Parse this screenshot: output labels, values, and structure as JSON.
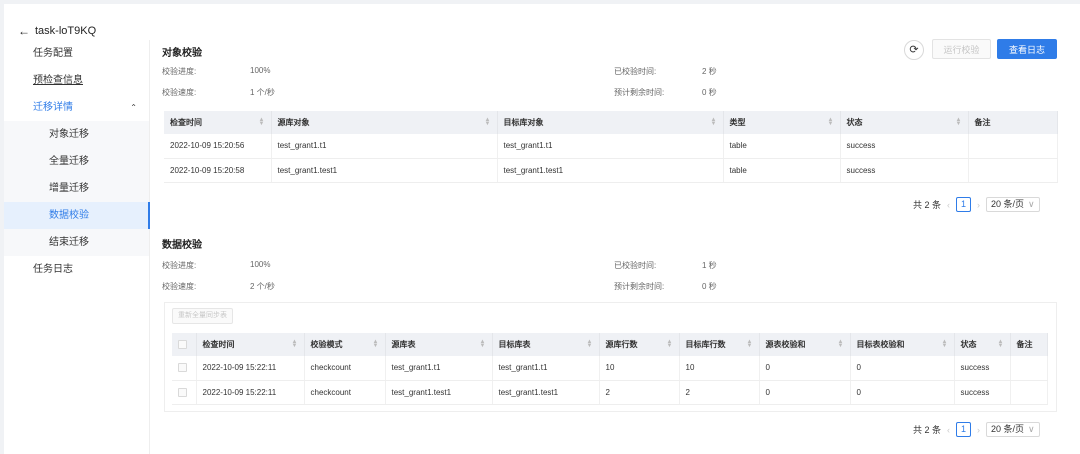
{
  "header": {
    "back_icon": "arrow-left-icon",
    "title": "task-loT9KQ"
  },
  "sidebar": {
    "items": [
      {
        "label": "任务配置"
      },
      {
        "label": "预检查信息"
      },
      {
        "label": "迁移详情"
      }
    ],
    "sub_items": [
      {
        "label": "对象迁移"
      },
      {
        "label": "全量迁移"
      },
      {
        "label": "增量迁移"
      },
      {
        "label": "数据校验"
      },
      {
        "label": "结束迁移"
      }
    ],
    "last_item": {
      "label": "任务日志"
    }
  },
  "toolbar": {
    "run_check_label": "运行校验",
    "view_log_label": "查看日志"
  },
  "object_check": {
    "title": "对象校验",
    "progress_label": "校验进度:",
    "progress_value": "100%",
    "speed_label": "校验速度:",
    "speed_value": "1 个/秒",
    "elapsed_label": "已校验时间:",
    "elapsed_value": "2 秒",
    "remaining_label": "预计剩余时间:",
    "remaining_value": "0 秒",
    "columns": [
      "检查时间",
      "源库对象",
      "目标库对象",
      "类型",
      "状态",
      "备注"
    ],
    "rows": [
      [
        "2022-10-09 15:20:56",
        "test_grant1.t1",
        "test_grant1.t1",
        "table",
        "success",
        ""
      ],
      [
        "2022-10-09 15:20:58",
        "test_grant1.test1",
        "test_grant1.test1",
        "table",
        "success",
        ""
      ]
    ],
    "pager": {
      "total": "共 2 条",
      "page": "1",
      "size": "20 条/页"
    }
  },
  "data_check": {
    "title": "数据校验",
    "progress_label": "校验进度:",
    "progress_value": "100%",
    "speed_label": "校验速度:",
    "speed_value": "2 个/秒",
    "elapsed_label": "已校验时间:",
    "elapsed_value": "1 秒",
    "remaining_label": "预计剩余时间:",
    "remaining_value": "0 秒",
    "batch_button": "重新全量同步表",
    "columns": [
      "检查时间",
      "校验模式",
      "源库表",
      "目标库表",
      "源库行数",
      "目标库行数",
      "源表校验和",
      "目标表校验和",
      "状态",
      "备注"
    ],
    "rows": [
      [
        "2022-10-09 15:22:11",
        "checkcount",
        "test_grant1.t1",
        "test_grant1.t1",
        "10",
        "10",
        "0",
        "0",
        "success",
        ""
      ],
      [
        "2022-10-09 15:22:11",
        "checkcount",
        "test_grant1.test1",
        "test_grant1.test1",
        "2",
        "2",
        "0",
        "0",
        "success",
        ""
      ]
    ],
    "pager": {
      "total": "共 2 条",
      "page": "1",
      "size": "20 条/页"
    }
  }
}
